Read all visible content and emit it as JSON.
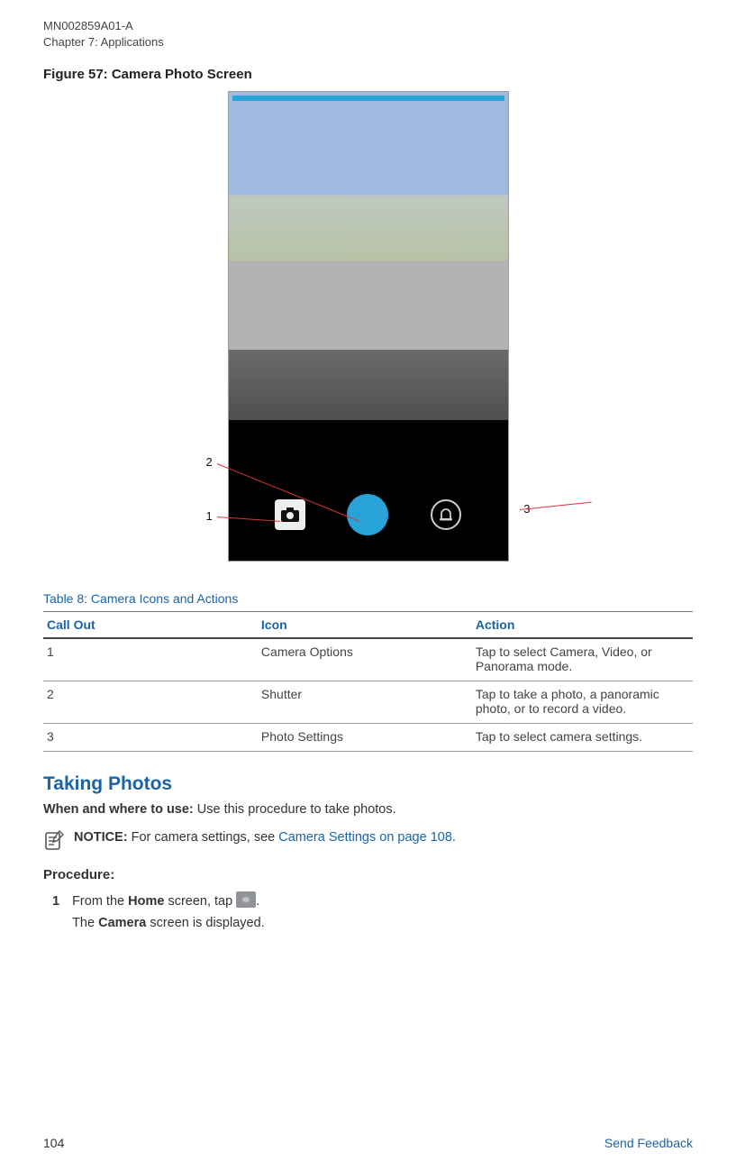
{
  "header": {
    "doc_id": "MN002859A01-A",
    "chapter": "Chapter 7:  Applications"
  },
  "figure": {
    "caption": "Figure 57: Camera Photo Screen",
    "callouts": {
      "one": "1",
      "two": "2",
      "three": "3"
    }
  },
  "table": {
    "title": "Table 8: Camera Icons and Actions",
    "headers": {
      "callout": "Call Out",
      "icon": "Icon",
      "action": "Action"
    },
    "rows": [
      {
        "callout": "1",
        "icon": "Camera Options",
        "action": "Tap to select Camera, Video, or Panorama mode."
      },
      {
        "callout": "2",
        "icon": "Shutter",
        "action": "Tap to take a photo, a panoramic photo, or to record a video."
      },
      {
        "callout": "3",
        "icon": "Photo Settings",
        "action": "Tap to select camera settings."
      }
    ]
  },
  "section": {
    "title": "Taking Photos",
    "when_label": "When and where to use:",
    "when_text": " Use this procedure to take photos.",
    "notice_label": "NOTICE:",
    "notice_text_before": " For camera settings, see ",
    "notice_link": "Camera Settings on page 108",
    "notice_text_after": ".",
    "procedure_label": "Procedure:",
    "step1": {
      "num": "1",
      "line1_before": "From the ",
      "line1_bold1": "Home",
      "line1_mid": " screen, tap ",
      "line1_after": ".",
      "line2_before": "The ",
      "line2_bold": "Camera",
      "line2_after": " screen is displayed."
    }
  },
  "footer": {
    "page": "104",
    "send": "Send Feedback"
  }
}
